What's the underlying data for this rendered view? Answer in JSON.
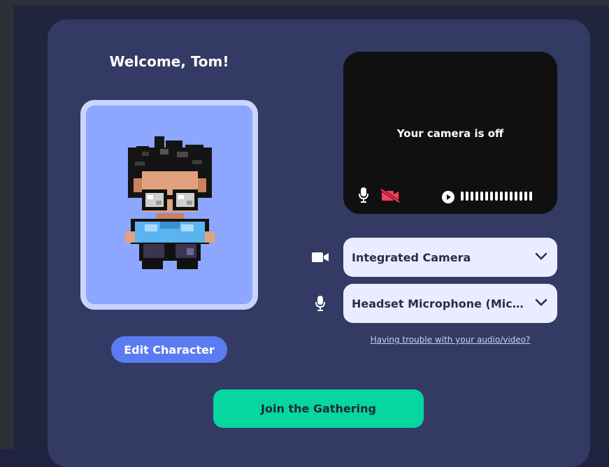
{
  "welcome": "Welcome, Tom!",
  "avatar": {
    "icon": "pixel-character-icon"
  },
  "edit_character_label": "Edit Character",
  "video_preview": {
    "status": "Your camera is off",
    "mic_icon": "microphone-icon",
    "camera_icon": "camera-off-icon",
    "play_icon": "play-icon"
  },
  "camera_select": {
    "icon": "video-camera-icon",
    "value": "Integrated Camera"
  },
  "microphone_select": {
    "icon": "microphone-icon",
    "value": "Headset Microphone (Micr..."
  },
  "trouble_link": "Having trouble with your audio/video?",
  "join_label": "Join the Gathering",
  "colors": {
    "card": "#333a63",
    "accent_blue": "#5a7cf0",
    "join_green": "#06d6a0",
    "camera_off_red": "#ff3d5a",
    "select_bg": "#e9edff"
  }
}
